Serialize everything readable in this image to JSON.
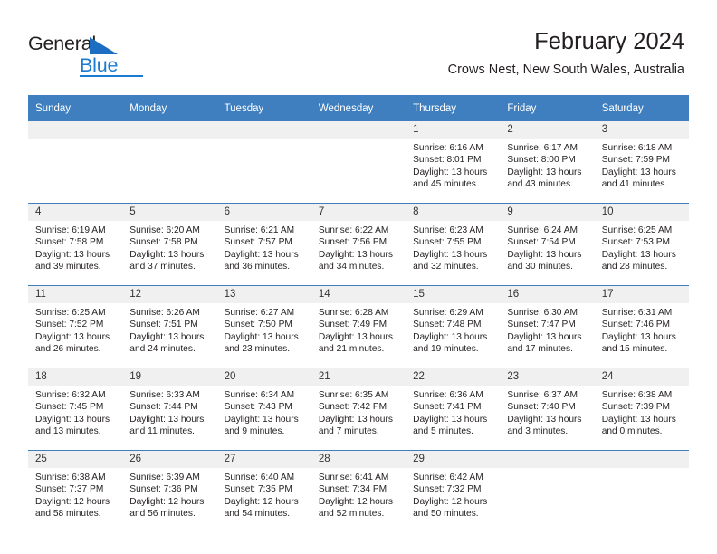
{
  "brand": {
    "name_top": "General",
    "name_bottom": "Blue",
    "accent_color": "#1b7bd0",
    "triangle_icon": "triangle-icon"
  },
  "header": {
    "title": "February 2024",
    "location": "Crows Nest, New South Wales, Australia",
    "header_bg_color": "#3f7fbf",
    "band_bg_color": "#f0f0f0"
  },
  "weekday_headers": [
    "Sunday",
    "Monday",
    "Tuesday",
    "Wednesday",
    "Thursday",
    "Friday",
    "Saturday"
  ],
  "labels": {
    "sunrise": "Sunrise:",
    "sunset": "Sunset:",
    "daylight": "Daylight:"
  },
  "weeks": [
    [
      {
        "day": "",
        "sunrise": "",
        "sunset": "",
        "daylight_line1": "",
        "daylight_line2": ""
      },
      {
        "day": "",
        "sunrise": "",
        "sunset": "",
        "daylight_line1": "",
        "daylight_line2": ""
      },
      {
        "day": "",
        "sunrise": "",
        "sunset": "",
        "daylight_line1": "",
        "daylight_line2": ""
      },
      {
        "day": "",
        "sunrise": "",
        "sunset": "",
        "daylight_line1": "",
        "daylight_line2": ""
      },
      {
        "day": "1",
        "sunrise": "Sunrise: 6:16 AM",
        "sunset": "Sunset: 8:01 PM",
        "daylight_line1": "Daylight: 13 hours",
        "daylight_line2": "and 45 minutes."
      },
      {
        "day": "2",
        "sunrise": "Sunrise: 6:17 AM",
        "sunset": "Sunset: 8:00 PM",
        "daylight_line1": "Daylight: 13 hours",
        "daylight_line2": "and 43 minutes."
      },
      {
        "day": "3",
        "sunrise": "Sunrise: 6:18 AM",
        "sunset": "Sunset: 7:59 PM",
        "daylight_line1": "Daylight: 13 hours",
        "daylight_line2": "and 41 minutes."
      }
    ],
    [
      {
        "day": "4",
        "sunrise": "Sunrise: 6:19 AM",
        "sunset": "Sunset: 7:58 PM",
        "daylight_line1": "Daylight: 13 hours",
        "daylight_line2": "and 39 minutes."
      },
      {
        "day": "5",
        "sunrise": "Sunrise: 6:20 AM",
        "sunset": "Sunset: 7:58 PM",
        "daylight_line1": "Daylight: 13 hours",
        "daylight_line2": "and 37 minutes."
      },
      {
        "day": "6",
        "sunrise": "Sunrise: 6:21 AM",
        "sunset": "Sunset: 7:57 PM",
        "daylight_line1": "Daylight: 13 hours",
        "daylight_line2": "and 36 minutes."
      },
      {
        "day": "7",
        "sunrise": "Sunrise: 6:22 AM",
        "sunset": "Sunset: 7:56 PM",
        "daylight_line1": "Daylight: 13 hours",
        "daylight_line2": "and 34 minutes."
      },
      {
        "day": "8",
        "sunrise": "Sunrise: 6:23 AM",
        "sunset": "Sunset: 7:55 PM",
        "daylight_line1": "Daylight: 13 hours",
        "daylight_line2": "and 32 minutes."
      },
      {
        "day": "9",
        "sunrise": "Sunrise: 6:24 AM",
        "sunset": "Sunset: 7:54 PM",
        "daylight_line1": "Daylight: 13 hours",
        "daylight_line2": "and 30 minutes."
      },
      {
        "day": "10",
        "sunrise": "Sunrise: 6:25 AM",
        "sunset": "Sunset: 7:53 PM",
        "daylight_line1": "Daylight: 13 hours",
        "daylight_line2": "and 28 minutes."
      }
    ],
    [
      {
        "day": "11",
        "sunrise": "Sunrise: 6:25 AM",
        "sunset": "Sunset: 7:52 PM",
        "daylight_line1": "Daylight: 13 hours",
        "daylight_line2": "and 26 minutes."
      },
      {
        "day": "12",
        "sunrise": "Sunrise: 6:26 AM",
        "sunset": "Sunset: 7:51 PM",
        "daylight_line1": "Daylight: 13 hours",
        "daylight_line2": "and 24 minutes."
      },
      {
        "day": "13",
        "sunrise": "Sunrise: 6:27 AM",
        "sunset": "Sunset: 7:50 PM",
        "daylight_line1": "Daylight: 13 hours",
        "daylight_line2": "and 23 minutes."
      },
      {
        "day": "14",
        "sunrise": "Sunrise: 6:28 AM",
        "sunset": "Sunset: 7:49 PM",
        "daylight_line1": "Daylight: 13 hours",
        "daylight_line2": "and 21 minutes."
      },
      {
        "day": "15",
        "sunrise": "Sunrise: 6:29 AM",
        "sunset": "Sunset: 7:48 PM",
        "daylight_line1": "Daylight: 13 hours",
        "daylight_line2": "and 19 minutes."
      },
      {
        "day": "16",
        "sunrise": "Sunrise: 6:30 AM",
        "sunset": "Sunset: 7:47 PM",
        "daylight_line1": "Daylight: 13 hours",
        "daylight_line2": "and 17 minutes."
      },
      {
        "day": "17",
        "sunrise": "Sunrise: 6:31 AM",
        "sunset": "Sunset: 7:46 PM",
        "daylight_line1": "Daylight: 13 hours",
        "daylight_line2": "and 15 minutes."
      }
    ],
    [
      {
        "day": "18",
        "sunrise": "Sunrise: 6:32 AM",
        "sunset": "Sunset: 7:45 PM",
        "daylight_line1": "Daylight: 13 hours",
        "daylight_line2": "and 13 minutes."
      },
      {
        "day": "19",
        "sunrise": "Sunrise: 6:33 AM",
        "sunset": "Sunset: 7:44 PM",
        "daylight_line1": "Daylight: 13 hours",
        "daylight_line2": "and 11 minutes."
      },
      {
        "day": "20",
        "sunrise": "Sunrise: 6:34 AM",
        "sunset": "Sunset: 7:43 PM",
        "daylight_line1": "Daylight: 13 hours",
        "daylight_line2": "and 9 minutes."
      },
      {
        "day": "21",
        "sunrise": "Sunrise: 6:35 AM",
        "sunset": "Sunset: 7:42 PM",
        "daylight_line1": "Daylight: 13 hours",
        "daylight_line2": "and 7 minutes."
      },
      {
        "day": "22",
        "sunrise": "Sunrise: 6:36 AM",
        "sunset": "Sunset: 7:41 PM",
        "daylight_line1": "Daylight: 13 hours",
        "daylight_line2": "and 5 minutes."
      },
      {
        "day": "23",
        "sunrise": "Sunrise: 6:37 AM",
        "sunset": "Sunset: 7:40 PM",
        "daylight_line1": "Daylight: 13 hours",
        "daylight_line2": "and 3 minutes."
      },
      {
        "day": "24",
        "sunrise": "Sunrise: 6:38 AM",
        "sunset": "Sunset: 7:39 PM",
        "daylight_line1": "Daylight: 13 hours",
        "daylight_line2": "and 0 minutes."
      }
    ],
    [
      {
        "day": "25",
        "sunrise": "Sunrise: 6:38 AM",
        "sunset": "Sunset: 7:37 PM",
        "daylight_line1": "Daylight: 12 hours",
        "daylight_line2": "and 58 minutes."
      },
      {
        "day": "26",
        "sunrise": "Sunrise: 6:39 AM",
        "sunset": "Sunset: 7:36 PM",
        "daylight_line1": "Daylight: 12 hours",
        "daylight_line2": "and 56 minutes."
      },
      {
        "day": "27",
        "sunrise": "Sunrise: 6:40 AM",
        "sunset": "Sunset: 7:35 PM",
        "daylight_line1": "Daylight: 12 hours",
        "daylight_line2": "and 54 minutes."
      },
      {
        "day": "28",
        "sunrise": "Sunrise: 6:41 AM",
        "sunset": "Sunset: 7:34 PM",
        "daylight_line1": "Daylight: 12 hours",
        "daylight_line2": "and 52 minutes."
      },
      {
        "day": "29",
        "sunrise": "Sunrise: 6:42 AM",
        "sunset": "Sunset: 7:32 PM",
        "daylight_line1": "Daylight: 12 hours",
        "daylight_line2": "and 50 minutes."
      },
      {
        "day": "",
        "sunrise": "",
        "sunset": "",
        "daylight_line1": "",
        "daylight_line2": ""
      },
      {
        "day": "",
        "sunrise": "",
        "sunset": "",
        "daylight_line1": "",
        "daylight_line2": ""
      }
    ]
  ]
}
